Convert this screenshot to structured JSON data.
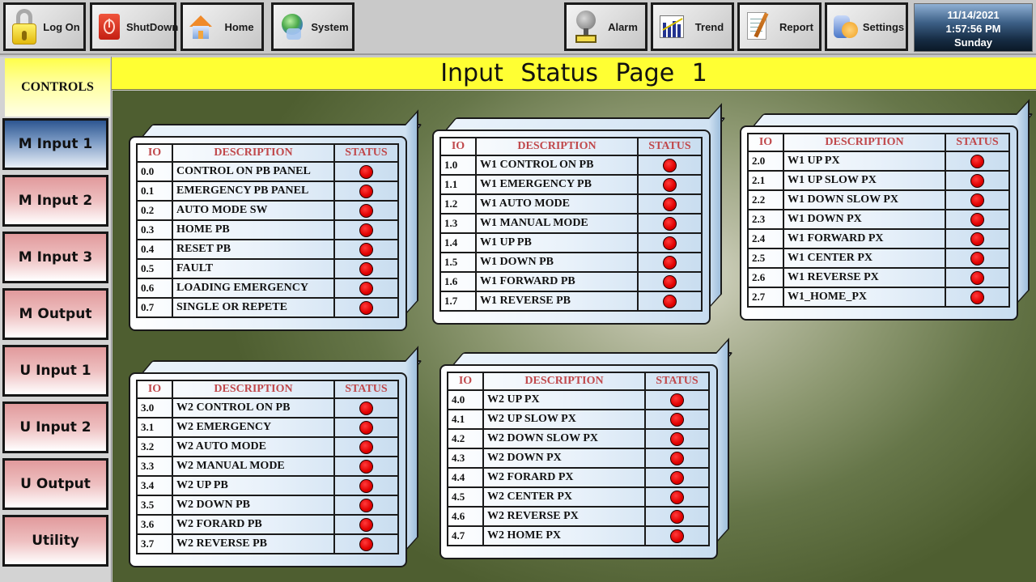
{
  "toolbar": {
    "buttons": [
      {
        "label": "Log On",
        "icon": "lock-icon"
      },
      {
        "label": "ShutDown",
        "icon": "power-icon"
      },
      {
        "label": "Home",
        "icon": "home-icon"
      },
      {
        "label": "System",
        "icon": "globe-icon"
      },
      {
        "label": "Alarm",
        "icon": "bell-icon"
      },
      {
        "label": "Trend",
        "icon": "trend-chart-icon"
      },
      {
        "label": "Report",
        "icon": "report-icon"
      },
      {
        "label": "Settings",
        "icon": "settings-icon"
      }
    ],
    "datetime": {
      "date": "11/14/2021",
      "time": "1:57:56 PM",
      "day": "Sunday"
    }
  },
  "sidebar": {
    "header": "CONTROLS",
    "items": [
      {
        "label": "M Input 1",
        "active": true
      },
      {
        "label": "M Input 2",
        "active": false
      },
      {
        "label": "M Input 3",
        "active": false
      },
      {
        "label": "M Output",
        "active": false
      },
      {
        "label": "U Input 1",
        "active": false
      },
      {
        "label": "U Input 2",
        "active": false
      },
      {
        "label": "U Output",
        "active": false
      },
      {
        "label": "Utility",
        "active": false
      }
    ]
  },
  "page_title": "Input Status Page 1",
  "colors": {
    "title_bar": "#ffff33",
    "header_text": "#c0484b",
    "status_off": "#e00000"
  },
  "panels": [
    {
      "headers": [
        "IO",
        "DESCRIPTION",
        "STATUS"
      ],
      "rows": [
        {
          "io": "0.0",
          "desc": "CONTROL ON PB PANEL",
          "status": "off"
        },
        {
          "io": "0.1",
          "desc": "EMERGENCY PB PANEL",
          "status": "off"
        },
        {
          "io": "0.2",
          "desc": "AUTO MODE SW",
          "status": "off"
        },
        {
          "io": "0.3",
          "desc": "HOME PB",
          "status": "off"
        },
        {
          "io": "0.4",
          "desc": "RESET PB",
          "status": "off"
        },
        {
          "io": "0.5",
          "desc": "FAULT",
          "status": "off"
        },
        {
          "io": "0.6",
          "desc": "LOADING EMERGENCY",
          "status": "off"
        },
        {
          "io": "0.7",
          "desc": "SINGLE OR REPETE",
          "status": "off"
        }
      ]
    },
    {
      "headers": [
        "IO",
        "DESCRIPTION",
        "STATUS"
      ],
      "rows": [
        {
          "io": "1.0",
          "desc": "W1 CONTROL ON PB",
          "status": "off"
        },
        {
          "io": "1.1",
          "desc": "W1 EMERGENCY PB",
          "status": "off"
        },
        {
          "io": "1.2",
          "desc": "W1 AUTO MODE",
          "status": "off"
        },
        {
          "io": "1.3",
          "desc": "W1 MANUAL MODE",
          "status": "off"
        },
        {
          "io": "1.4",
          "desc": "W1 UP PB",
          "status": "off"
        },
        {
          "io": "1.5",
          "desc": "W1 DOWN PB",
          "status": "off"
        },
        {
          "io": "1.6",
          "desc": "W1 FORWARD PB",
          "status": "off"
        },
        {
          "io": "1.7",
          "desc": "W1 REVERSE PB",
          "status": "off"
        }
      ]
    },
    {
      "headers": [
        "IO",
        "DESCRIPTION",
        "STATUS"
      ],
      "rows": [
        {
          "io": "2.0",
          "desc": "W1 UP PX",
          "status": "off"
        },
        {
          "io": "2.1",
          "desc": "W1 UP SLOW PX",
          "status": "off"
        },
        {
          "io": "2.2",
          "desc": "W1 DOWN SLOW PX",
          "status": "off"
        },
        {
          "io": "2.3",
          "desc": "W1 DOWN PX",
          "status": "off"
        },
        {
          "io": "2.4",
          "desc": "W1 FORWARD PX",
          "status": "off"
        },
        {
          "io": "2.5",
          "desc": "W1 CENTER PX",
          "status": "off"
        },
        {
          "io": "2.6",
          "desc": "W1 REVERSE PX",
          "status": "off"
        },
        {
          "io": "2.7",
          "desc": "W1_HOME_PX",
          "status": "off"
        }
      ]
    },
    {
      "headers": [
        "IO",
        "DESCRIPTION",
        "STATUS"
      ],
      "rows": [
        {
          "io": "3.0",
          "desc": "W2 CONTROL ON PB",
          "status": "off"
        },
        {
          "io": "3.1",
          "desc": "W2 EMERGENCY",
          "status": "off"
        },
        {
          "io": "3.2",
          "desc": "W2 AUTO MODE",
          "status": "off"
        },
        {
          "io": "3.3",
          "desc": "W2 MANUAL MODE",
          "status": "off"
        },
        {
          "io": "3.4",
          "desc": "W2 UP PB",
          "status": "off"
        },
        {
          "io": "3.5",
          "desc": "W2 DOWN PB",
          "status": "off"
        },
        {
          "io": "3.6",
          "desc": "W2 FORARD PB",
          "status": "off"
        },
        {
          "io": "3.7",
          "desc": "W2 REVERSE PB",
          "status": "off"
        }
      ]
    },
    {
      "headers": [
        "IO",
        "DESCRIPTION",
        "STATUS"
      ],
      "rows": [
        {
          "io": "4.0",
          "desc": "W2 UP PX",
          "status": "off"
        },
        {
          "io": "4.1",
          "desc": "W2 UP SLOW PX",
          "status": "off"
        },
        {
          "io": "4.2",
          "desc": "W2 DOWN SLOW PX",
          "status": "off"
        },
        {
          "io": "4.3",
          "desc": "W2 DOWN PX",
          "status": "off"
        },
        {
          "io": "4.4",
          "desc": "W2 FORARD PX",
          "status": "off"
        },
        {
          "io": "4.5",
          "desc": "W2 CENTER PX",
          "status": "off"
        },
        {
          "io": "4.6",
          "desc": "W2 REVERSE PX",
          "status": "off"
        },
        {
          "io": "4.7",
          "desc": "W2 HOME PX",
          "status": "off"
        }
      ]
    }
  ]
}
